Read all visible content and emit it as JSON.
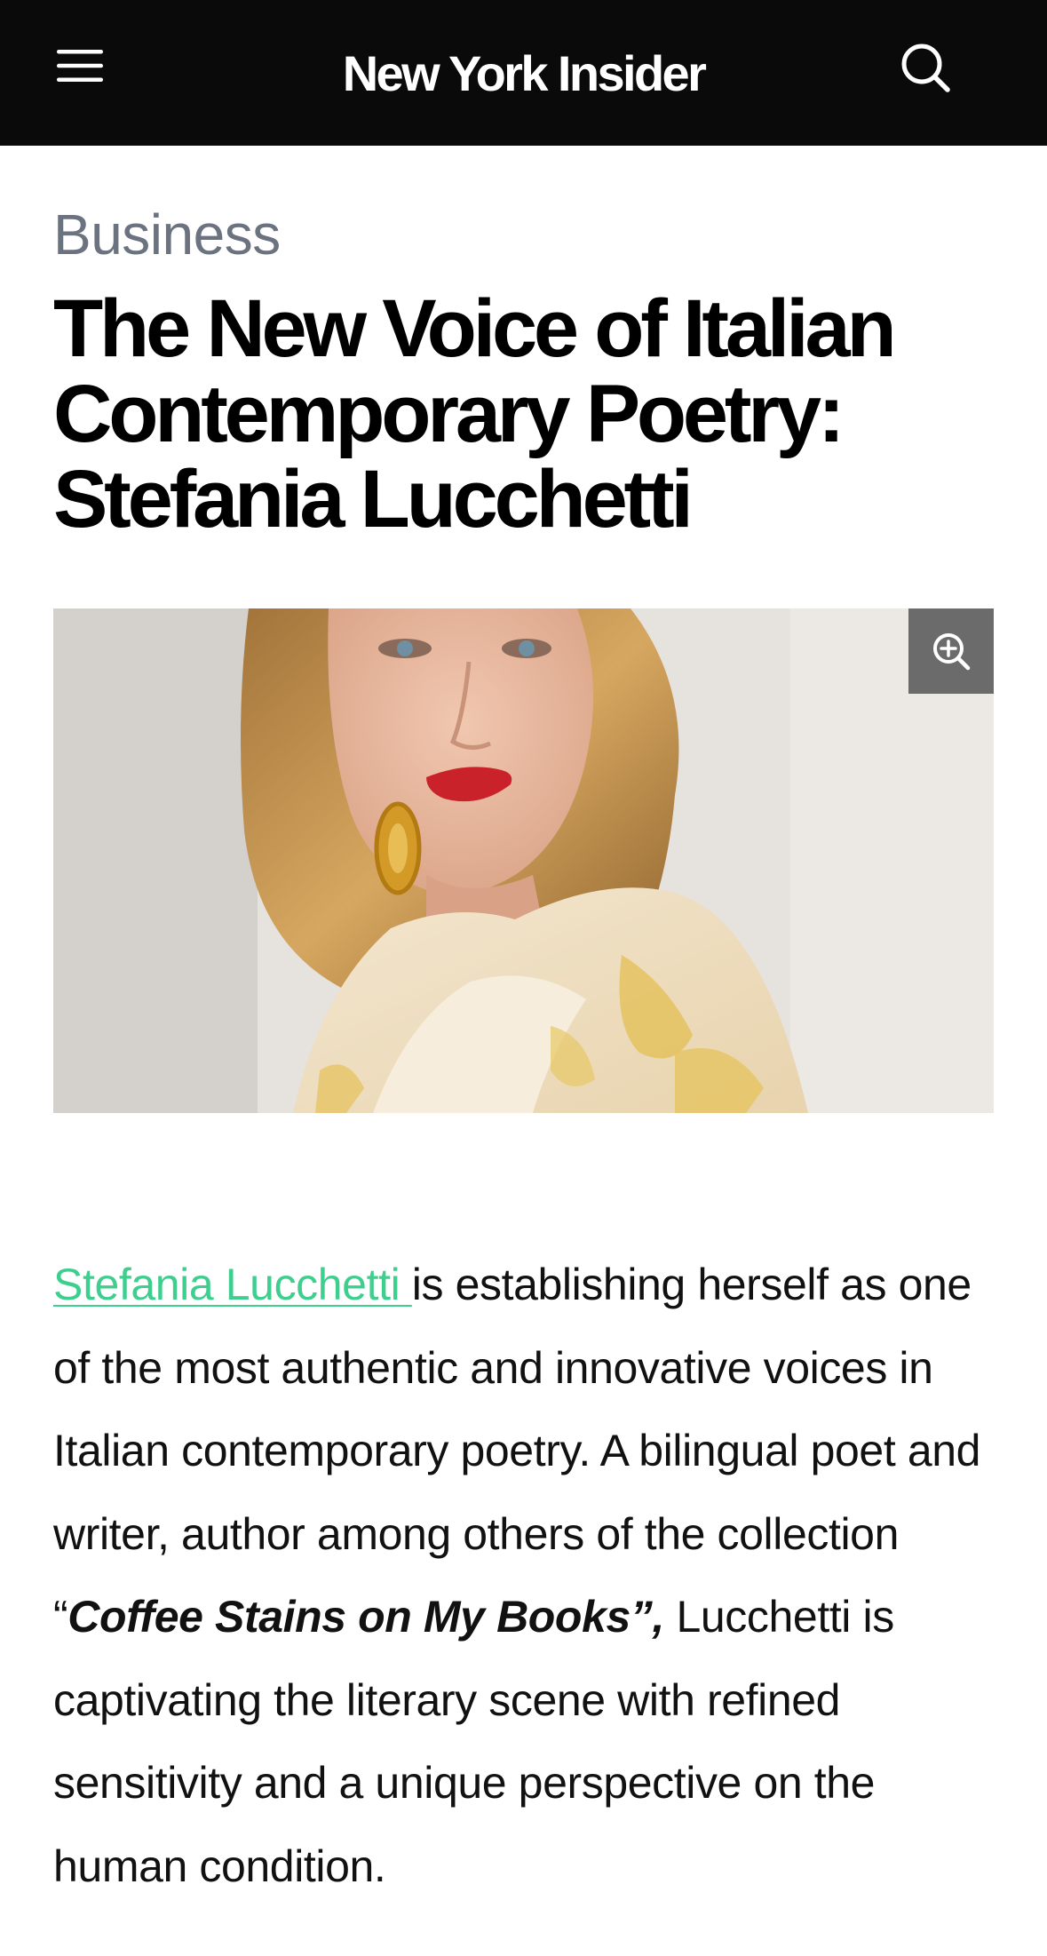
{
  "header": {
    "site_title": "New York Insider",
    "menu_icon": "hamburger-menu-icon",
    "search_icon": "search-icon",
    "background": "#0a0a0a"
  },
  "article": {
    "category": "Business",
    "title": "The New Voice of Italian Contemporary Poetry: Stefania Lucchetti",
    "image_zoom_icon": "zoom-in-icon",
    "body": {
      "author_link": "Stefania Lucchetti ",
      "part1": "is establishing herself as one of the most authentic and innovative voices in Italian contemporary poetry. A bilingual poet and writer, author among others of the collection “",
      "book_title": "Coffee Stains on My Books”,",
      "part2": " Lucchetti is captivating the literary scene with refined sensitivity and a unique perspective on the human condition."
    }
  },
  "colors": {
    "link": "#3ecf8e",
    "category": "#6b7280",
    "zoom_button": "#6b6b6b"
  }
}
